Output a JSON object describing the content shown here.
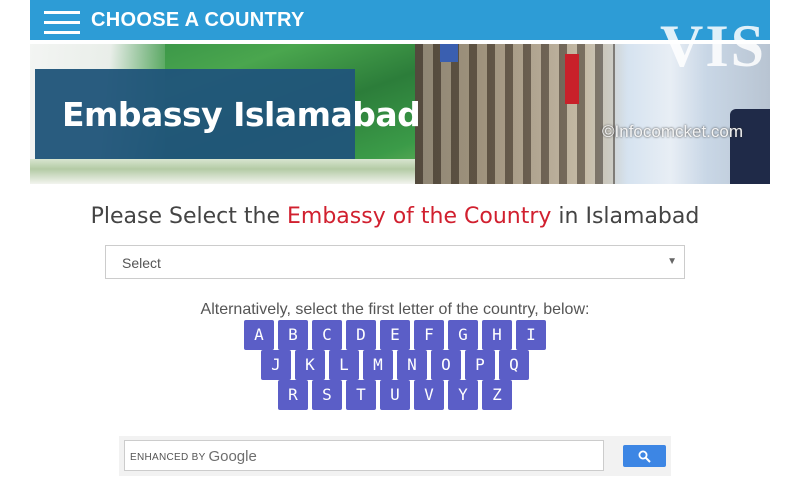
{
  "header": {
    "title": "CHOOSE A COUNTRY"
  },
  "banner": {
    "title": "Embassy Islamabad",
    "copyright": "©Infocomcket.com",
    "visa_text": "VIS"
  },
  "heading": {
    "before": "Please Select the ",
    "accent": "Embassy of the Country",
    "after": " in Islamabad",
    "accent_color": "#d1202f"
  },
  "select": {
    "value": "Select"
  },
  "alphabet": {
    "intro": "Alternatively, select the first letter of the country, below:",
    "rows": [
      [
        "A",
        "B",
        "C",
        "D",
        "E",
        "F",
        "G",
        "H",
        "I"
      ],
      [
        "J",
        "K",
        "L",
        "M",
        "N",
        "O",
        "P",
        "Q"
      ],
      [
        "R",
        "S",
        "T",
        "U",
        "V",
        "Y",
        "Z"
      ]
    ]
  },
  "search": {
    "brand_prefix": "ENHANCED BY",
    "brand_name": "Google"
  },
  "colors": {
    "topbar": "#2d9cd6",
    "letter_button": "#5b5ec7",
    "search_button": "#3d86e4"
  },
  "icons": {
    "menu": "hamburger-icon",
    "search": "search-icon",
    "dropdown": "chevron-down-icon"
  }
}
